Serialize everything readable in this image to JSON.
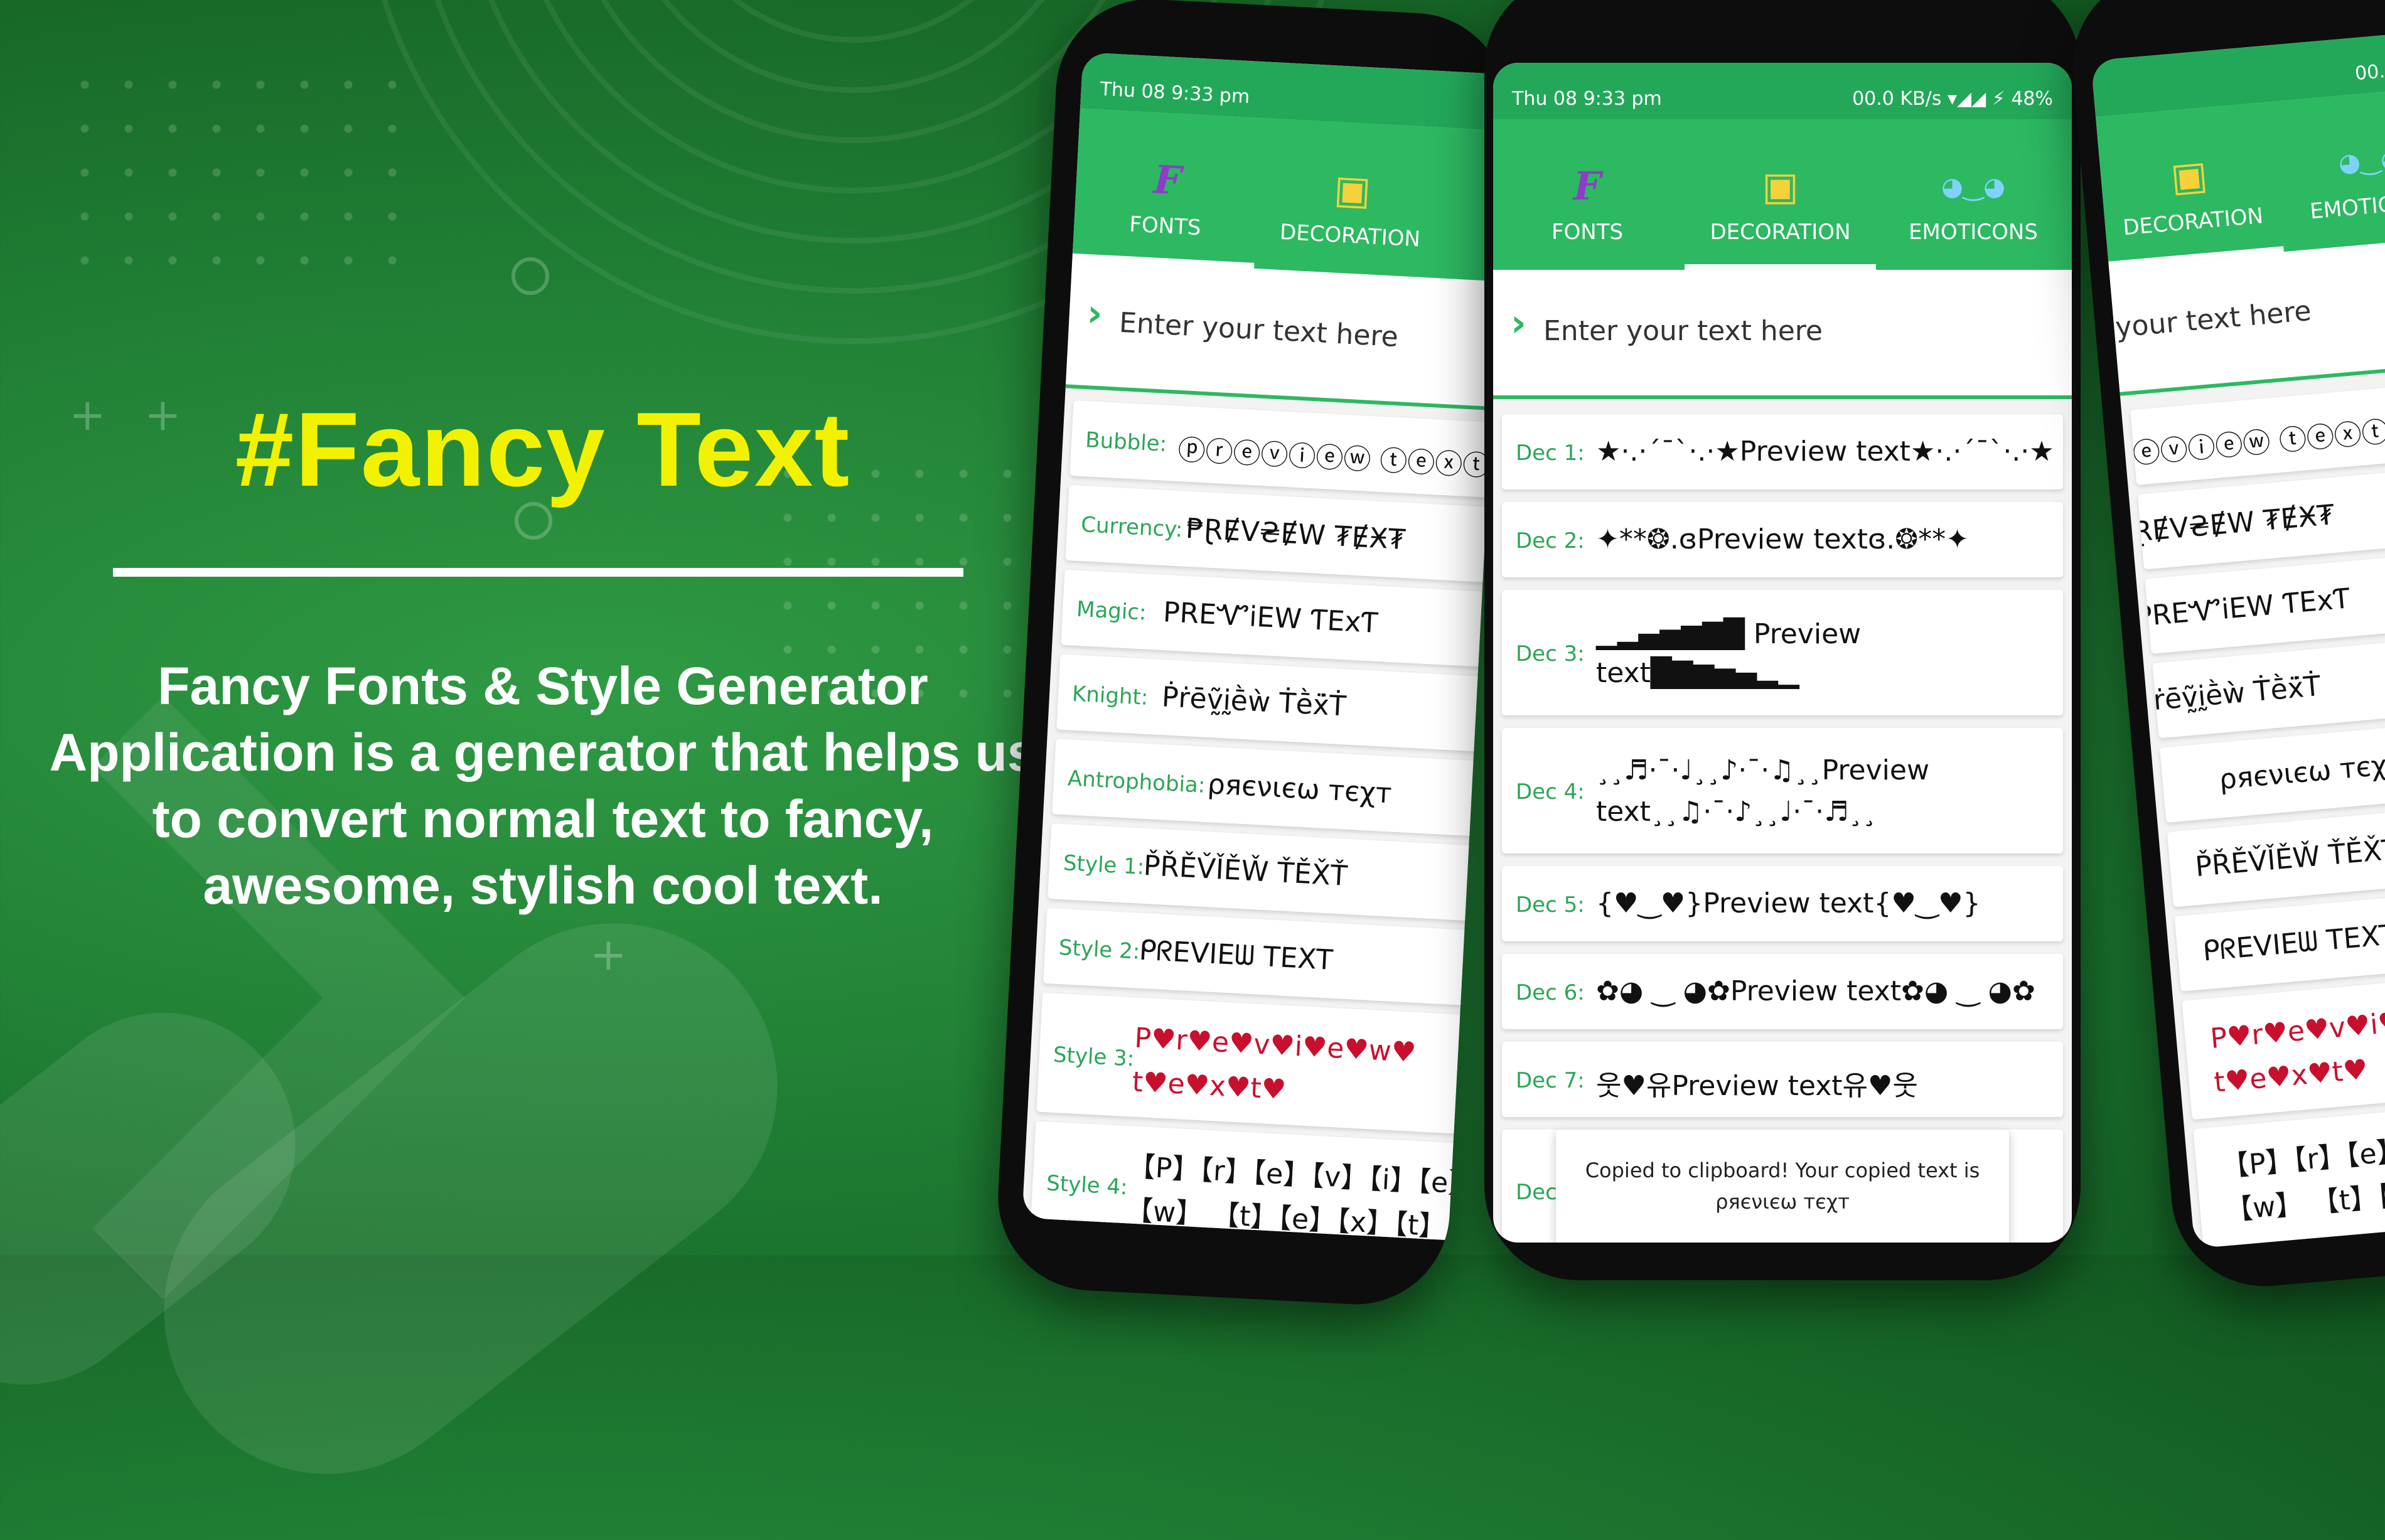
{
  "promo": {
    "title": "#Fancy Text",
    "description": "Fancy Fonts & Style Generator Application is a generator that helps us to convert normal text to fancy, awesome, stylish cool text."
  },
  "colors": {
    "accent_yellow": "#f2f200",
    "app_green": "#2db862",
    "label_green": "#2ba656"
  },
  "status_bar": {
    "time": "Thu 08 9:33 pm",
    "net_speed": "00.0 KB/s",
    "battery": "48%"
  },
  "tabs": [
    {
      "label": "FONTS",
      "icon": "fonts-f-icon"
    },
    {
      "label": "DECORATION",
      "icon": "decoration-box-icon"
    },
    {
      "label": "EMOTICONS",
      "icon": "emoticons-face-icon"
    }
  ],
  "input": {
    "placeholder": "Enter your text here"
  },
  "font_styles": [
    {
      "label": "Bubble:",
      "value": "ⓟⓡⓔⓥⓘⓔⓦ ⓣⓔⓧⓣ"
    },
    {
      "label": "Currency:",
      "value": "₱ⱤɆV₴ɆW ₮ɆӾ₮"
    },
    {
      "label": "Magic:",
      "value": "PREᏉiEW ƬExƬ"
    },
    {
      "label": "Knight:",
      "value": "Ṗṙēṽ̰ḭḕẁ Ṫḕẍ̇Ṫ"
    },
    {
      "label": "Antrophobia:",
      "value": "ρяєνιєω тєχт"
    },
    {
      "label": "Style 1:",
      "value": "P̌ŘĚV̌ǏĚW̌ ŤĚX̌Ť"
    },
    {
      "label": "Style 2:",
      "value": "ᑭᖇEᐯIEᗯ TEXT"
    },
    {
      "label": "Style 3:",
      "value": "P♥r♥e♥v♥i♥e♥w♥ t♥e♥x♥t♥"
    },
    {
      "label": "Style 4:",
      "value": "【P】【r】【e】【v】【i】【e】【w】 【t】【e】【x】【t】"
    }
  ],
  "decorations": [
    {
      "label": "Dec 1:",
      "value": "★·.·´¯`·.·★Preview text★·.·´¯`·.·★"
    },
    {
      "label": "Dec 2:",
      "value": "✦**❂.ɞPreview textɞ.❂**✦"
    },
    {
      "label": "Dec 3:",
      "value": "▁▂▄▅▆▇█ Preview text█▇▆▅▄▂▁"
    },
    {
      "label": "Dec 4:",
      "value": "¸¸♬·¯·♩¸¸♪·¯·♫¸¸Preview text¸¸♫·¯·♪¸¸♩·¯·♬¸¸"
    },
    {
      "label": "Dec 5:",
      "value": "{♥‿♥}Preview text{♥‿♥}"
    },
    {
      "label": "Dec 6:",
      "value": "✿◕ ‿ ◕✿Preview text✿◕ ‿ ◕✿"
    },
    {
      "label": "Dec 7:",
      "value": "웃♥유Preview text유♥웃"
    },
    {
      "label": "Dec 8:",
      "value": ""
    }
  ],
  "toast": {
    "line1": "Copied to clipboard! Your copied text is",
    "line2": "ρяєνιєω тєχт"
  }
}
